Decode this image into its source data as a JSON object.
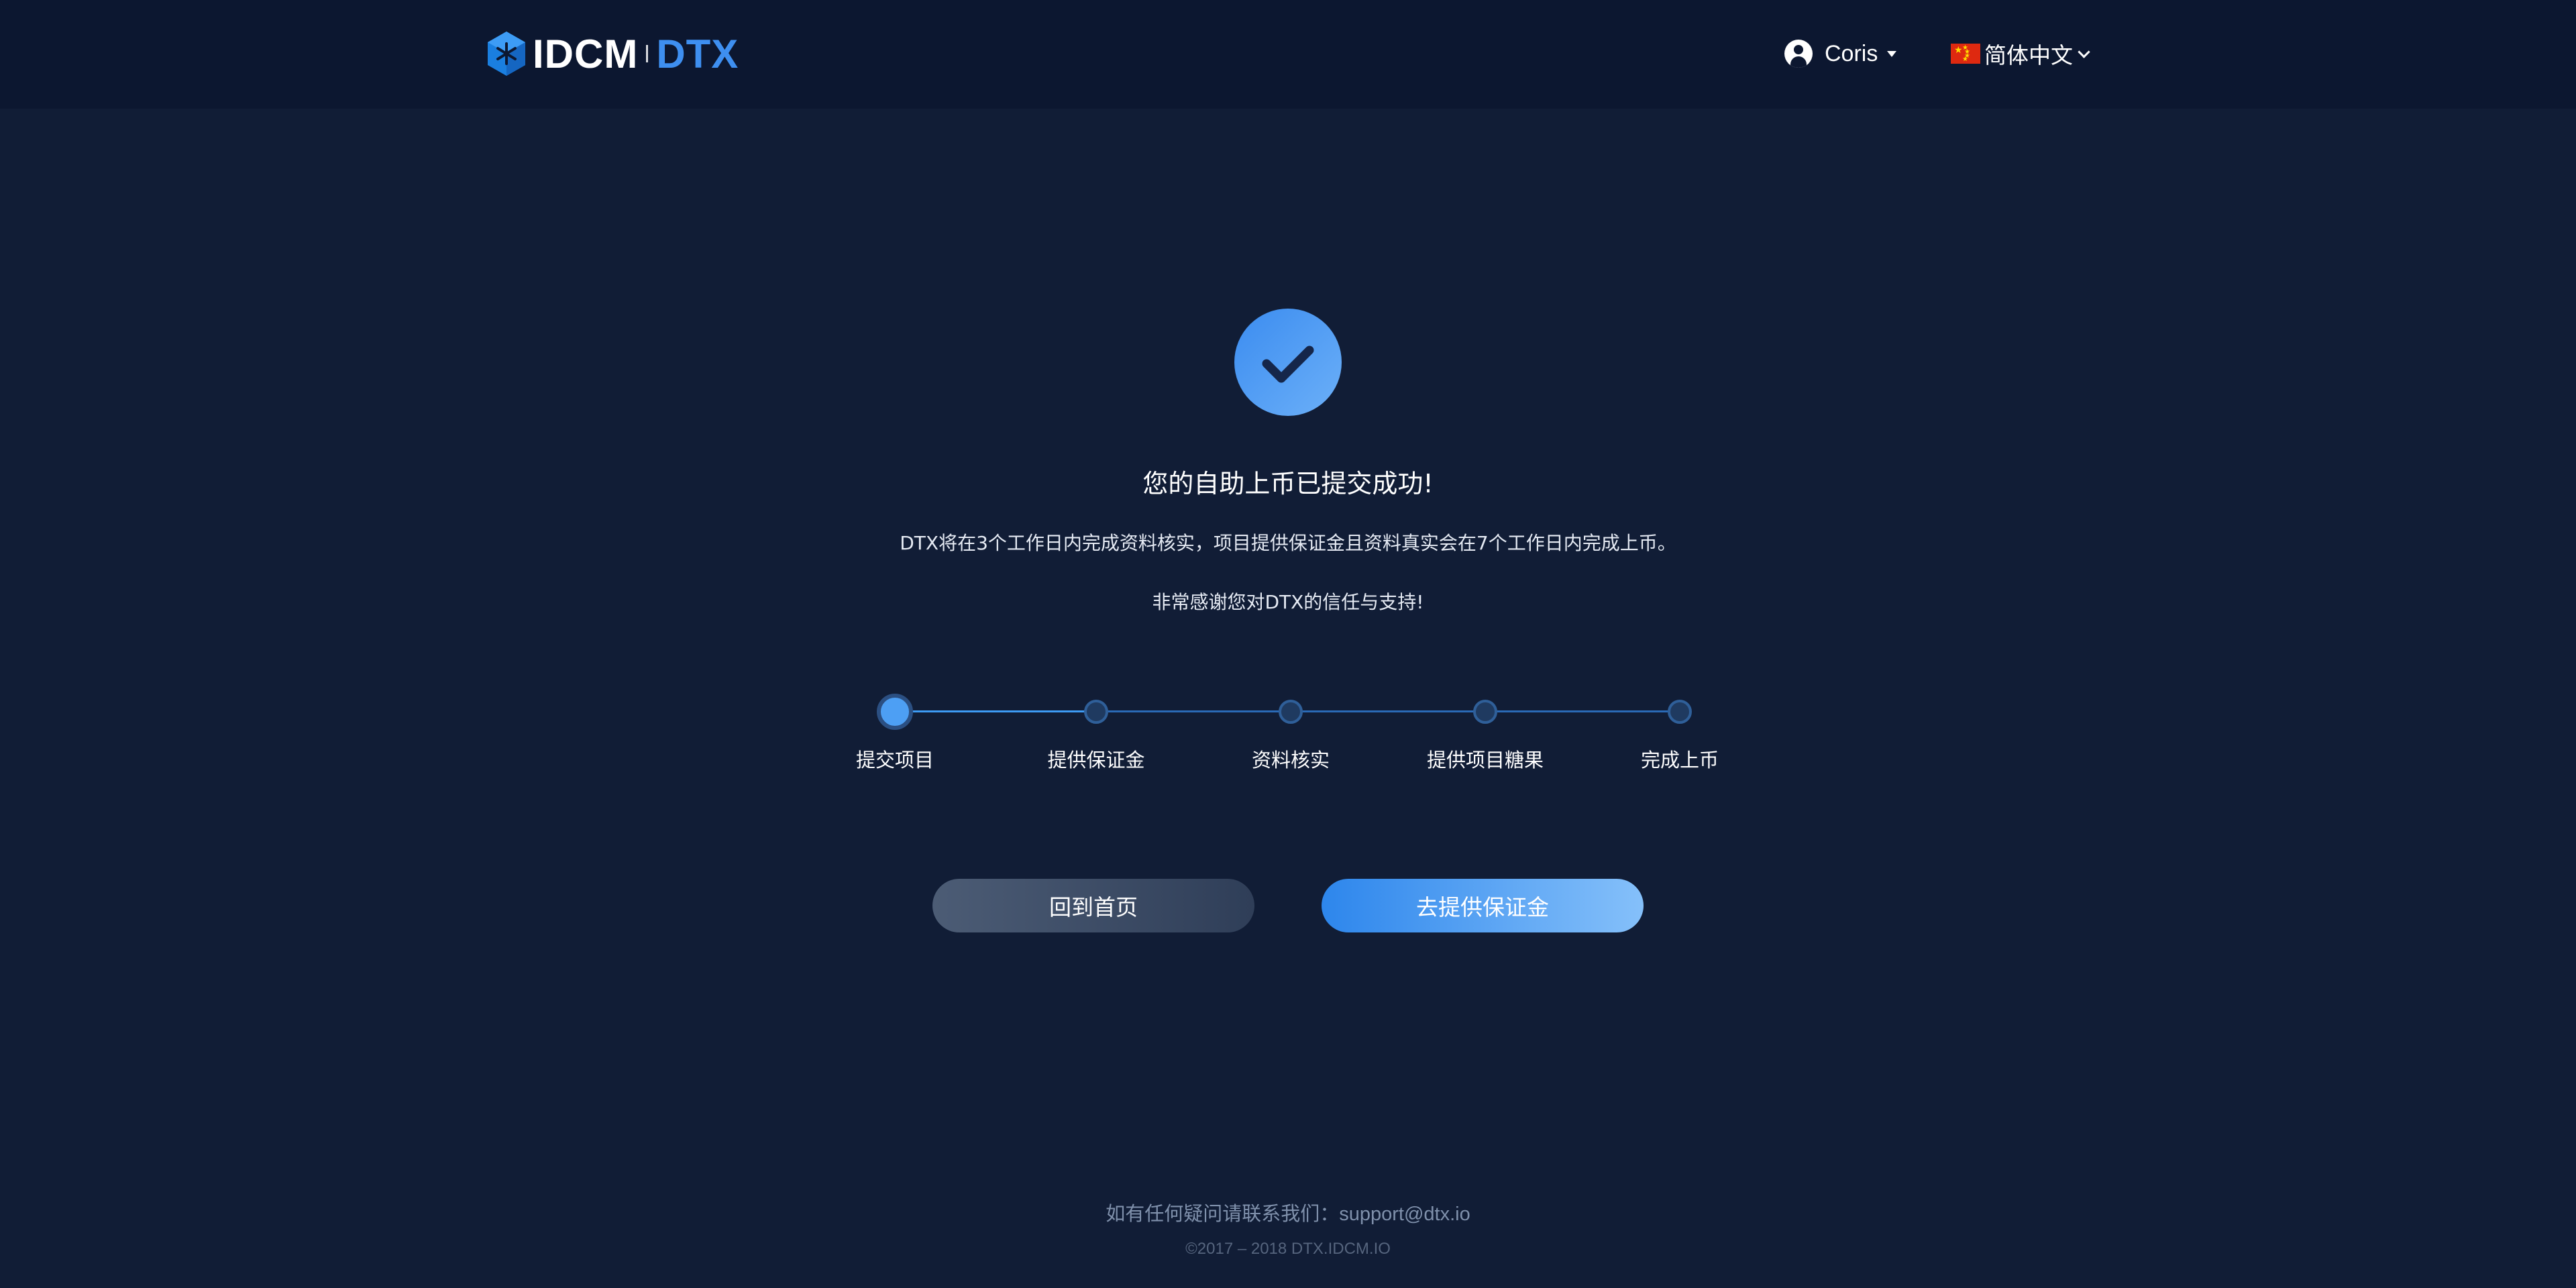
{
  "header": {
    "logo": {
      "brand": "IDCM",
      "product": "DTX"
    },
    "user": {
      "name": "Coris"
    },
    "language": {
      "label": "简体中文"
    }
  },
  "result": {
    "title": "您的自助上币已提交成功!",
    "description": "DTX将在3个工作日内完成资料核实，项目提供保证金且资料真实会在7个工作日内完成上币。",
    "thanks": "非常感谢您对DTX的信任与支持!"
  },
  "steps": {
    "current": 1,
    "items": [
      {
        "label": "提交项目"
      },
      {
        "label": "提供保证金"
      },
      {
        "label": "资料核实"
      },
      {
        "label": "提供项目糖果"
      },
      {
        "label": "完成上币"
      }
    ]
  },
  "actions": {
    "home_label": "回到首页",
    "deposit_label": "去提供保证金"
  },
  "footer": {
    "contact_prefix": "如有任何疑问请联系我们：",
    "email": "support@dtx.io",
    "copyright": "©2017 – 2018 DTX.IDCM.IO"
  },
  "colors": {
    "background": "#111d36",
    "header": "#0c1730",
    "accent": "#3e8ff0"
  }
}
